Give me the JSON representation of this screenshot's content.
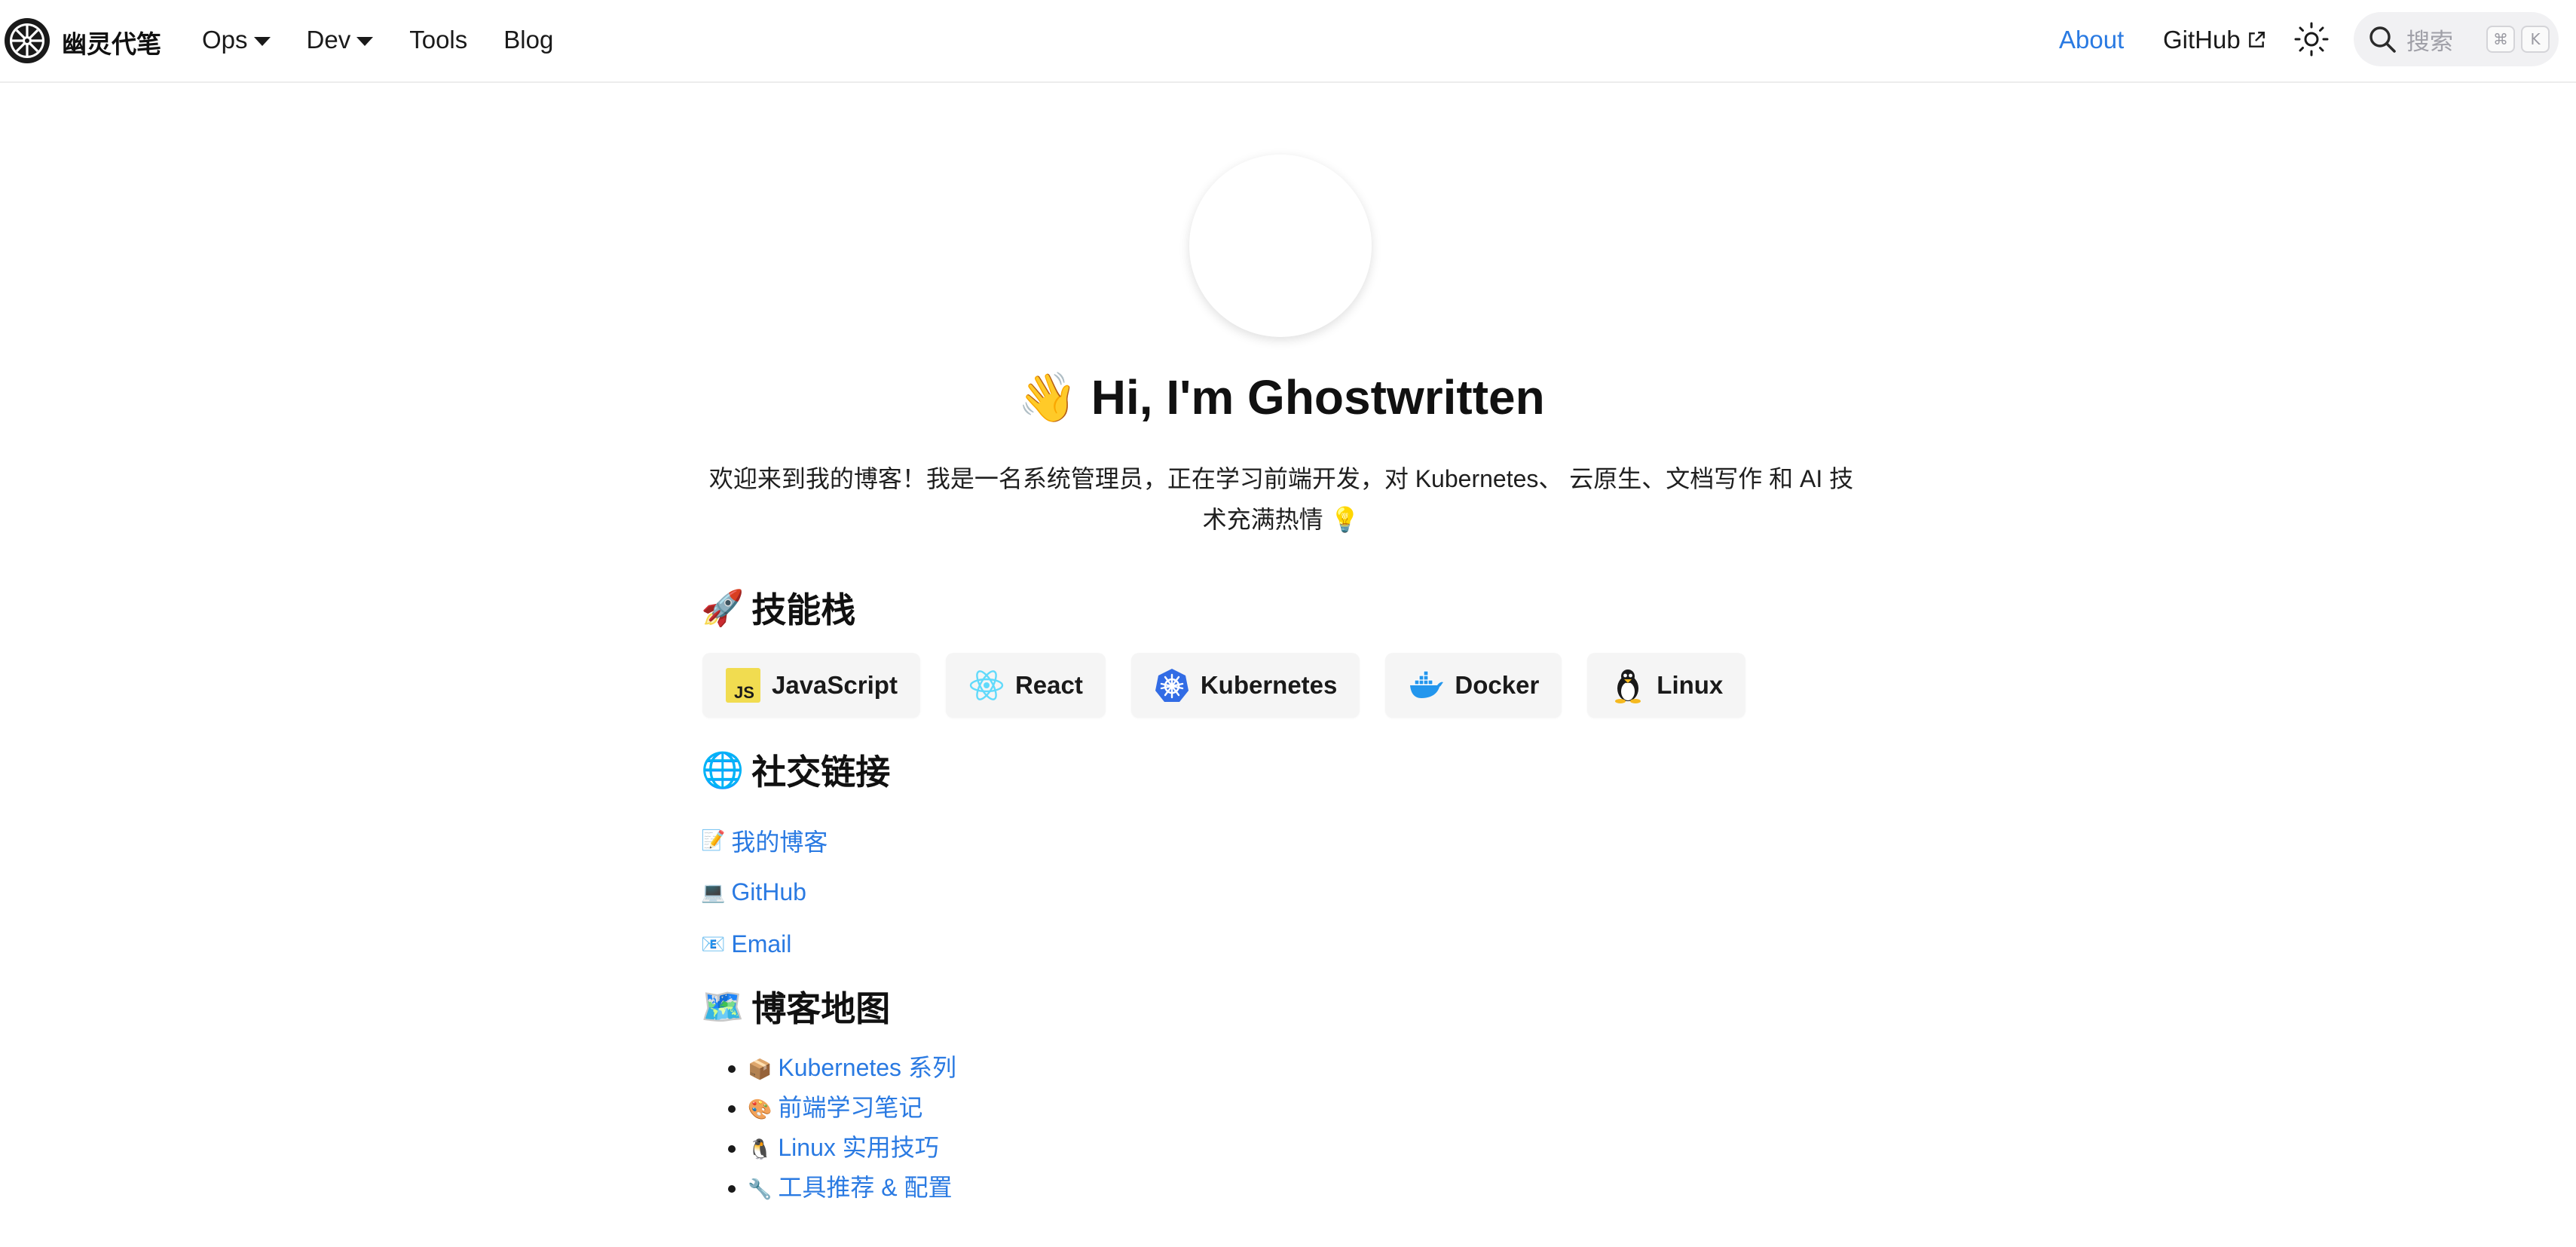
{
  "header": {
    "site_title": "幽灵代笔",
    "nav": [
      {
        "label": "Ops",
        "has_dropdown": true
      },
      {
        "label": "Dev",
        "has_dropdown": true
      },
      {
        "label": "Tools",
        "has_dropdown": false
      },
      {
        "label": "Blog",
        "has_dropdown": false
      }
    ],
    "about_label": "About",
    "github_label": "GitHub",
    "search_placeholder": "搜索",
    "search_shortcut_mod": "⌘",
    "search_shortcut_key": "K",
    "accent_color": "#2a7ae2"
  },
  "hero": {
    "wave_emoji": "👋",
    "title": "Hi, I'm Ghostwritten",
    "description_line1": "欢迎来到我的博客！我是一名系统管理员，正在学习前端开发，对 Kubernetes、 云原生、文档写作 和 AI 技",
    "description_line2": "术充满热情 💡"
  },
  "skills": {
    "emoji": "🚀",
    "heading": "技能栈",
    "items": [
      {
        "label": "JavaScript",
        "icon": "javascript-icon"
      },
      {
        "label": "React",
        "icon": "react-icon"
      },
      {
        "label": "Kubernetes",
        "icon": "kubernetes-icon"
      },
      {
        "label": "Docker",
        "icon": "docker-icon"
      },
      {
        "label": "Linux",
        "icon": "linux-icon"
      }
    ]
  },
  "social": {
    "emoji": "🌐",
    "heading": "社交链接",
    "links": [
      {
        "emoji": "📝",
        "label": "我的博客"
      },
      {
        "emoji": "💻",
        "label": "GitHub"
      },
      {
        "emoji": "📧",
        "label": "Email"
      }
    ]
  },
  "sitemap": {
    "emoji": "🗺️",
    "heading": "博客地图",
    "items": [
      {
        "emoji": "📦",
        "label": "Kubernetes 系列"
      },
      {
        "emoji": "🎨",
        "label": "前端学习笔记"
      },
      {
        "emoji": "🐧",
        "label": "Linux 实用技巧"
      },
      {
        "emoji": "🔧",
        "label": "工具推荐 & 配置"
      }
    ]
  }
}
